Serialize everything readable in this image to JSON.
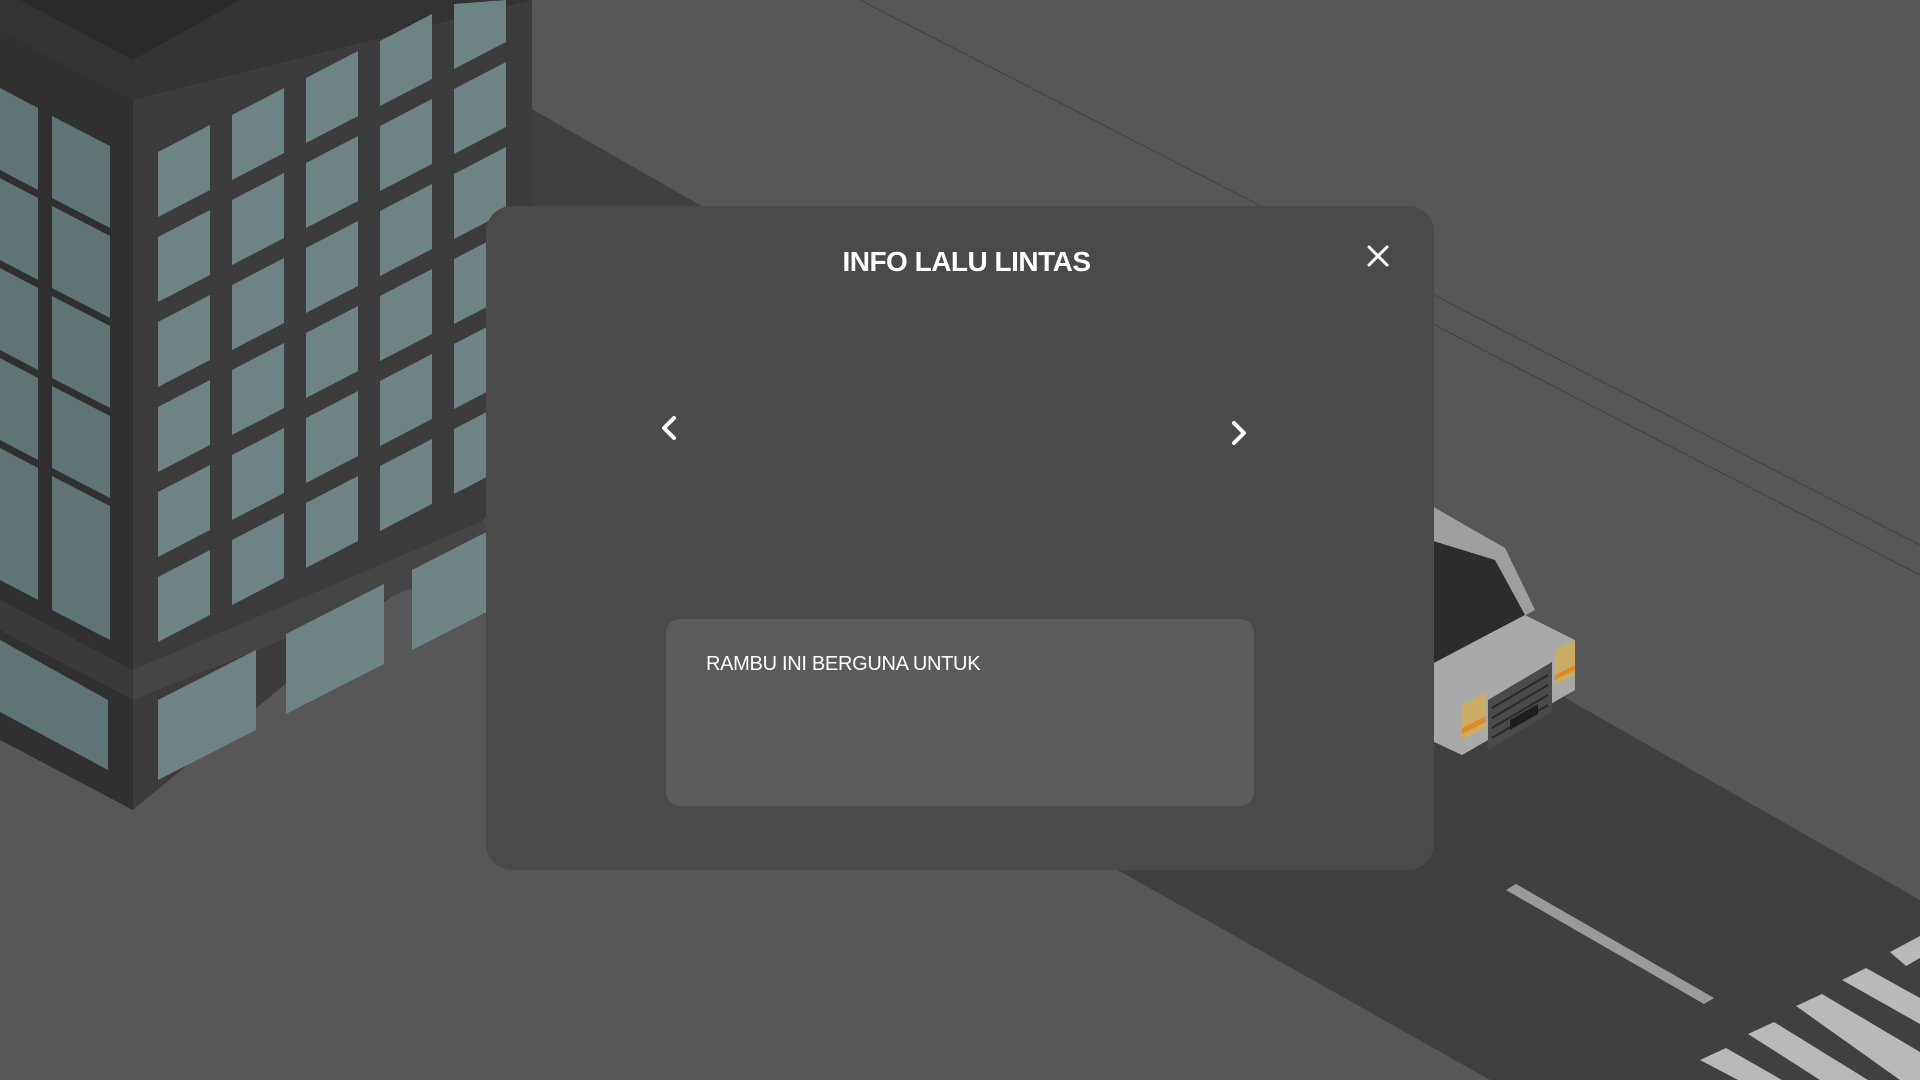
{
  "scene": {
    "background_color": "#575757",
    "road_color": "#3f403f",
    "building_glass_color": "#6e8384",
    "building_frame_color": "#3a3a3a",
    "car_body_color": "#a9a9a9"
  },
  "dialog": {
    "title": "INFO LALU LINTAS",
    "close_icon": "close-icon",
    "prev_icon": "chevron-left-icon",
    "next_icon": "chevron-right-icon",
    "info_text": "RAMBU INI BERGUNA UNTUK",
    "background_color": "#4a4a4a",
    "info_box_color": "#5a5b5d"
  }
}
